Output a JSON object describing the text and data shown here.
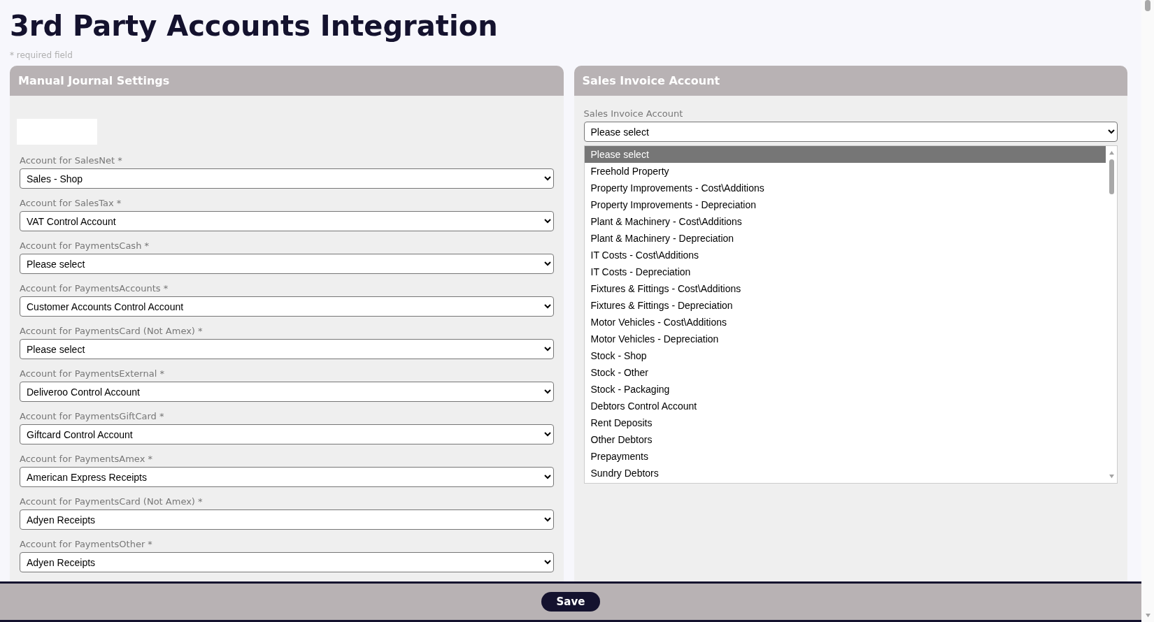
{
  "page": {
    "title": "3rd Party Accounts Integration",
    "required_note": "* required field"
  },
  "manual_journal": {
    "title": "Manual Journal Settings",
    "fields": [
      {
        "label": "Account for SalesNet *",
        "value": "Sales - Shop"
      },
      {
        "label": "Account for SalesTax *",
        "value": "VAT Control Account"
      },
      {
        "label": "Account for PaymentsCash *",
        "value": "Please select"
      },
      {
        "label": "Account for PaymentsAccounts *",
        "value": "Customer Accounts Control Account"
      },
      {
        "label": "Account for PaymentsCard (Not Amex) *",
        "value": "Please select"
      },
      {
        "label": "Account for PaymentsExternal *",
        "value": "Deliveroo Control Account"
      },
      {
        "label": "Account for PaymentsGiftCard *",
        "value": "Giftcard Control Account"
      },
      {
        "label": "Account for PaymentsAmex *",
        "value": "American Express Receipts"
      },
      {
        "label": "Account for PaymentsCard (Not Amex) *",
        "value": "Adyen Receipts"
      },
      {
        "label": "Account for PaymentsOther *",
        "value": "Adyen Receipts"
      }
    ]
  },
  "sales_invoice": {
    "title": "Sales Invoice Account",
    "field": {
      "label": "Sales Invoice Account",
      "value": "Please select"
    },
    "options": [
      {
        "label": "Please select",
        "selected": true
      },
      {
        "label": "Freehold Property",
        "selected": false
      },
      {
        "label": "Property Improvements - Cost\\Additions",
        "selected": false
      },
      {
        "label": "Property Improvements - Depreciation",
        "selected": false
      },
      {
        "label": "Plant & Machinery - Cost\\Additions",
        "selected": false
      },
      {
        "label": "Plant & Machinery - Depreciation",
        "selected": false
      },
      {
        "label": "IT Costs - Cost\\Additions",
        "selected": false
      },
      {
        "label": "IT Costs - Depreciation",
        "selected": false
      },
      {
        "label": "Fixtures & Fittings - Cost\\Additions",
        "selected": false
      },
      {
        "label": "Fixtures & Fittings - Depreciation",
        "selected": false
      },
      {
        "label": "Motor Vehicles - Cost\\Additions",
        "selected": false
      },
      {
        "label": "Motor Vehicles - Depreciation",
        "selected": false
      },
      {
        "label": "Stock - Shop",
        "selected": false
      },
      {
        "label": "Stock - Other",
        "selected": false
      },
      {
        "label": "Stock - Packaging",
        "selected": false
      },
      {
        "label": "Debtors Control Account",
        "selected": false
      },
      {
        "label": "Rent Deposits",
        "selected": false
      },
      {
        "label": "Other Debtors",
        "selected": false
      },
      {
        "label": "Prepayments",
        "selected": false
      },
      {
        "label": "Sundry Debtors",
        "selected": false
      }
    ]
  },
  "footer": {
    "save_button": "Save"
  }
}
